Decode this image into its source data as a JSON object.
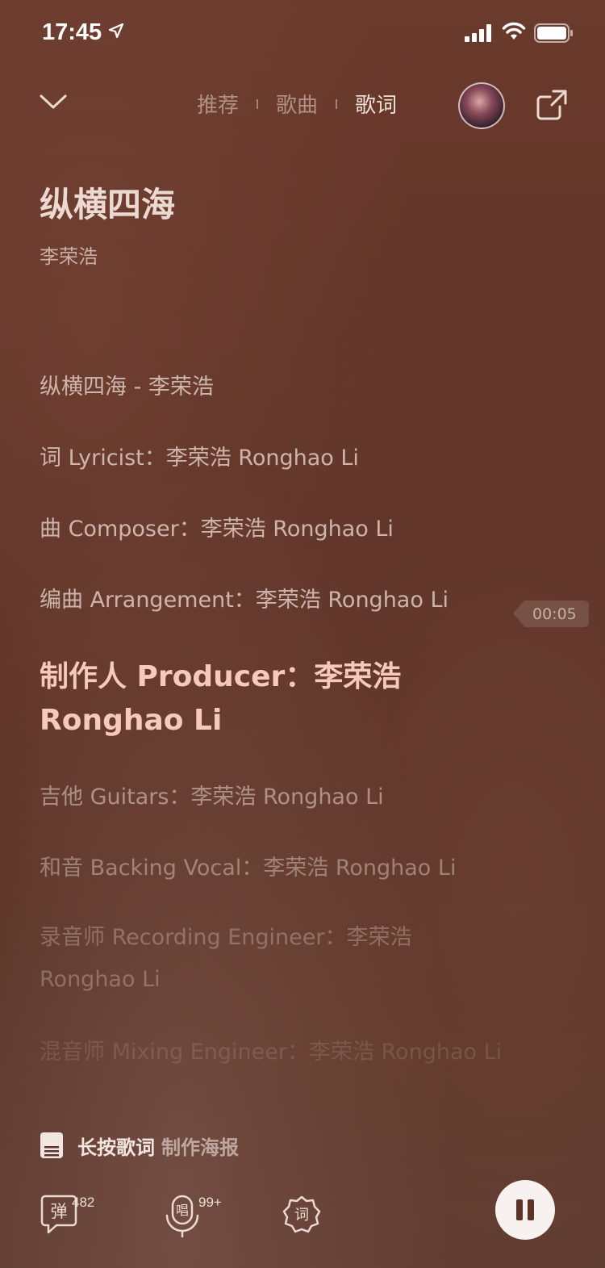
{
  "status_bar": {
    "time": "17:45"
  },
  "nav": {
    "tabs": [
      {
        "label": "推荐",
        "active": false
      },
      {
        "label": "歌曲",
        "active": false
      },
      {
        "label": "歌词",
        "active": true
      }
    ]
  },
  "song": {
    "title": "纵横四海",
    "artist": "李荣浩"
  },
  "lyrics": [
    "纵横四海 - 李荣浩",
    "词 Lyricist：李荣浩 Ronghao Li",
    "曲 Composer：李荣浩 Ronghao Li",
    "编曲 Arrangement：李荣浩 Ronghao Li",
    "制作人 Producer：李荣浩 Ronghao Li",
    "吉他 Guitars：李荣浩 Ronghao Li",
    "和音 Backing Vocal：李荣浩 Ronghao Li",
    "录音师 Recording Engineer：李荣浩 Ronghao Li",
    "混音师 Mixing Engineer：李荣浩 Ronghao Li"
  ],
  "current_lyric_index": 4,
  "timestamp_pill": "00:05",
  "poster_hint": {
    "bold_text": "长按歌词",
    "text": "制作海报"
  },
  "bottom": {
    "danmu_label": "弹",
    "danmu_count": "482",
    "sing_label": "唱",
    "sing_count": "99+",
    "lyric_tool_label": "词"
  },
  "colors": {
    "background": "#5e3327",
    "highlight_lyric": "#f6c9b9",
    "pause_button": "#f7f1ef"
  }
}
